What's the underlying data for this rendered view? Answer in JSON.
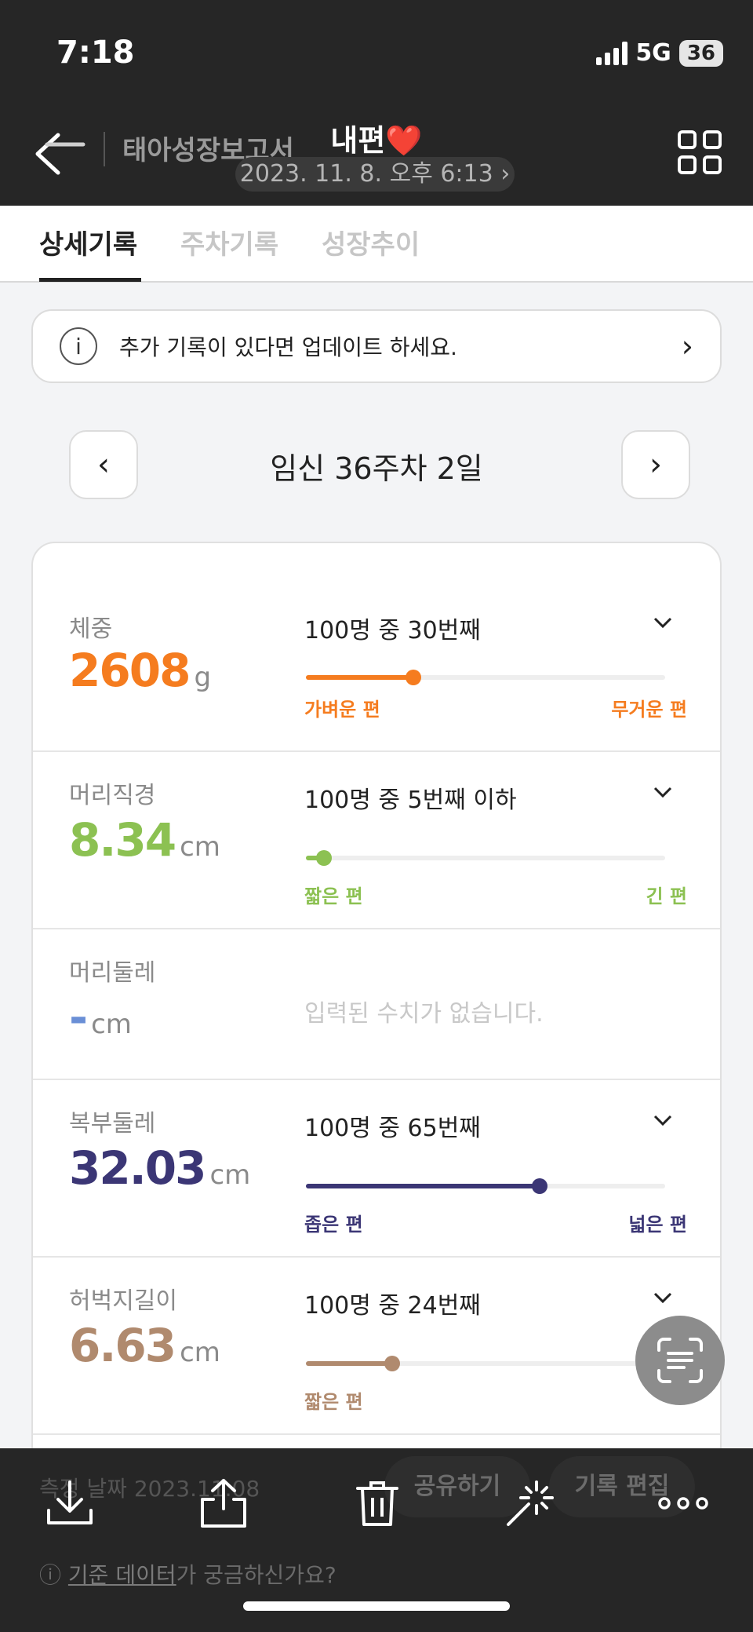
{
  "status": {
    "time": "7:18",
    "network": "5G",
    "battery": "36"
  },
  "header": {
    "back_title": "태아성장보고서",
    "title": "내편",
    "title_emoji": "❤️",
    "subtitle": "2023. 11. 8. 오후 6:13 ›"
  },
  "tabs": [
    {
      "label": "상세기록",
      "active": true
    },
    {
      "label": "주차기록",
      "active": false
    },
    {
      "label": "성장추이",
      "active": false
    }
  ],
  "notice": {
    "info_glyph": "i",
    "text": "추가 기록이 있다면 업데이트 하세요.",
    "chevron": "›"
  },
  "week": {
    "prev": "‹",
    "label": "임신 36주차 2일",
    "next": "›"
  },
  "metrics": [
    {
      "name": "체중",
      "value": "2608",
      "unit": "g",
      "color": "#f57c1f",
      "rank": "100명 중 30번째",
      "percentile": 30,
      "left_label": "가벼운 편",
      "right_label": "무거운 편"
    },
    {
      "name": "머리직경",
      "value": "8.34",
      "unit": "cm",
      "color": "#8cc152",
      "rank": "100명 중 5번째 이하",
      "percentile": 5,
      "left_label": "짧은 편",
      "right_label": "긴 편"
    },
    {
      "name": "머리둘레",
      "value": "-",
      "unit": "cm",
      "color": "#6a8fd6",
      "empty_text": "입력된 수치가 없습니다."
    },
    {
      "name": "복부둘레",
      "value": "32.03",
      "unit": "cm",
      "color": "#3b3675",
      "rank": "100명 중 65번째",
      "percentile": 65,
      "left_label": "좁은 편",
      "right_label": "넓은 편"
    },
    {
      "name": "허벅지길이",
      "value": "6.63",
      "unit": "cm",
      "color": "#b08a6e",
      "rank": "100명 중 24번째",
      "percentile": 24,
      "left_label": "짧은 편",
      "right_label": "긴 편"
    }
  ],
  "footer_ghost": {
    "date_text": "측정 날짜 2023.11.08",
    "share_label": "공유하기",
    "edit_label": "기록 편집",
    "ref_prefix": "ⓘ ",
    "ref_link": "기준 데이터",
    "ref_suffix": "가 궁금하신가요?"
  },
  "toolbar": {
    "download_icon": "download-icon",
    "share_icon": "share-icon",
    "delete_icon": "trash-icon",
    "enhance_icon": "magic-wand-icon",
    "more_icon": "more-icon"
  }
}
